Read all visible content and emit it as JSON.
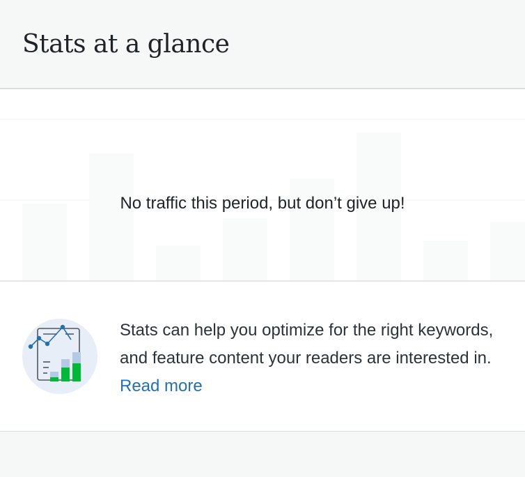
{
  "header": {
    "title": "Stats at a glance"
  },
  "chart": {
    "empty_message": "No traffic this period, but don’t give up!",
    "placeholder_bar_levels": [
      0.52,
      0.86,
      0.24,
      0.42,
      0.69,
      1.0,
      0.27,
      0.4
    ],
    "bar_color": "#f9fafa",
    "gridline_color": "#f0f0f1"
  },
  "info": {
    "text": "Stats can help you optimize for the right keywords, and feature content your readers are interested in.",
    "link_label": "Read more",
    "link_color": "#2271b1",
    "illustration_icon": "stats-illustration-icon"
  },
  "colors": {
    "background": "#f6f7f7",
    "panel": "#ffffff",
    "accent_green": "#00ba37",
    "accent_blue": "#b3c9e6"
  }
}
